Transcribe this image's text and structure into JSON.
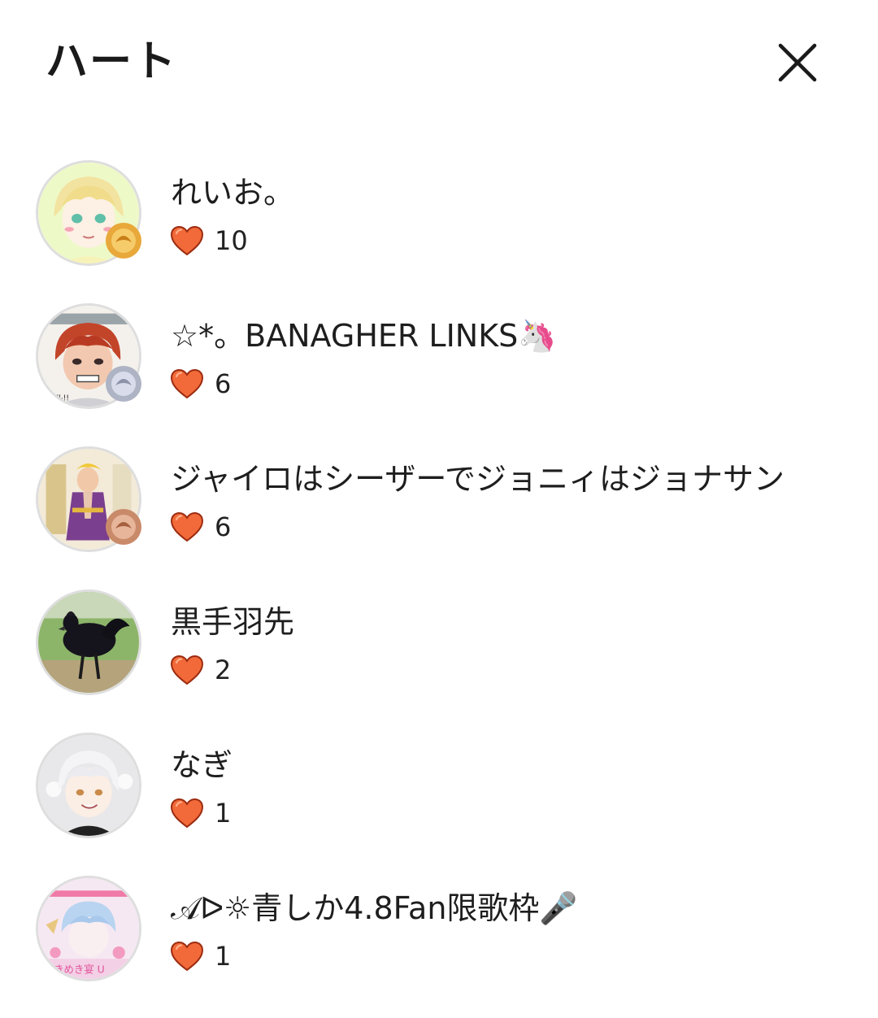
{
  "header": {
    "title": "ハート",
    "close_icon": "close-icon"
  },
  "colors": {
    "heart": "#f26a3a",
    "heart_outline": "#9c2c10",
    "avatar_border": "#dedede"
  },
  "users": [
    {
      "name": "れいお。",
      "hearts": "10",
      "badge": "gold"
    },
    {
      "name": "☆*。BANAGHER LINKS🦄",
      "hearts": "6",
      "badge": "silver"
    },
    {
      "name": "ジャイロはシーザーでジョニィはジョナサン",
      "hearts": "6",
      "badge": "bronze"
    },
    {
      "name": "黒手羽先",
      "hearts": "2",
      "badge": ""
    },
    {
      "name": "なぎ",
      "hearts": "1",
      "badge": ""
    },
    {
      "name": "𝒜ᐅ☼青しか4.8Fan限歌枠🎤",
      "hearts": "1",
      "badge": ""
    }
  ]
}
